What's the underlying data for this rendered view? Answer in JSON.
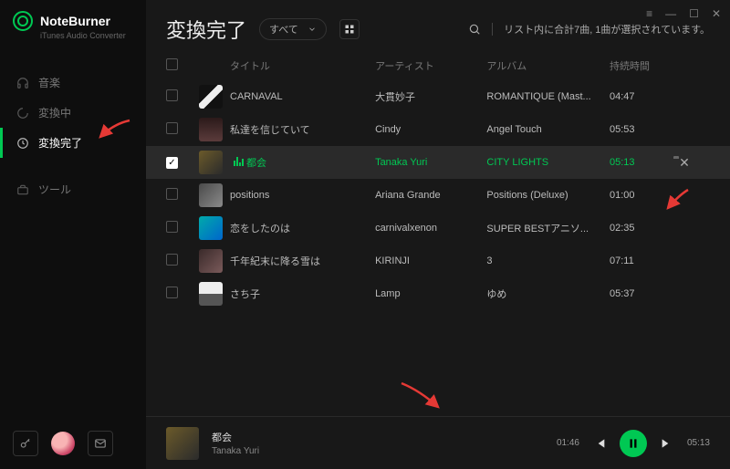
{
  "brand": {
    "title": "NoteBurner",
    "subtitle": "iTunes Audio Converter"
  },
  "nav": {
    "items": [
      {
        "label": "音楽",
        "icon": "headphones-icon"
      },
      {
        "label": "変換中",
        "icon": "spinner-icon"
      },
      {
        "label": "変換完了",
        "icon": "clock-icon"
      },
      {
        "label": "ツール",
        "icon": "toolbox-icon"
      }
    ],
    "activeIndex": 2
  },
  "header": {
    "title": "変換完了",
    "filterLabel": "すべて",
    "statusText": "リスト内に合計7曲, 1曲が選択されています。"
  },
  "columns": {
    "title": "タイトル",
    "artist": "アーティスト",
    "album": "アルバム",
    "duration": "持続時間"
  },
  "tracks": [
    {
      "title": "CARNAVAL",
      "artist": "大貫妙子",
      "album": "ROMANTIQUE (Mast...",
      "duration": "04:47",
      "checked": false,
      "selected": false
    },
    {
      "title": "私達を信じていて",
      "artist": "Cindy",
      "album": "Angel Touch",
      "duration": "05:53",
      "checked": false,
      "selected": false
    },
    {
      "title": "都会",
      "artist": "Tanaka Yuri",
      "album": "CITY LIGHTS",
      "duration": "05:13",
      "checked": true,
      "selected": true
    },
    {
      "title": "positions",
      "artist": "Ariana Grande",
      "album": "Positions (Deluxe)",
      "duration": "01:00",
      "checked": false,
      "selected": false
    },
    {
      "title": "恋をしたのは",
      "artist": "carnivalxenon",
      "album": "SUPER BESTアニソ...",
      "duration": "02:35",
      "checked": false,
      "selected": false
    },
    {
      "title": "千年紀末に降る雪は",
      "artist": "KIRINJI",
      "album": "3",
      "duration": "07:11",
      "checked": false,
      "selected": false
    },
    {
      "title": "さち子",
      "artist": "Lamp",
      "album": "ゆめ",
      "duration": "05:37",
      "checked": false,
      "selected": false
    }
  ],
  "player": {
    "title": "都会",
    "artist": "Tanaka Yuri",
    "elapsed": "01:46",
    "total": "05:13"
  }
}
